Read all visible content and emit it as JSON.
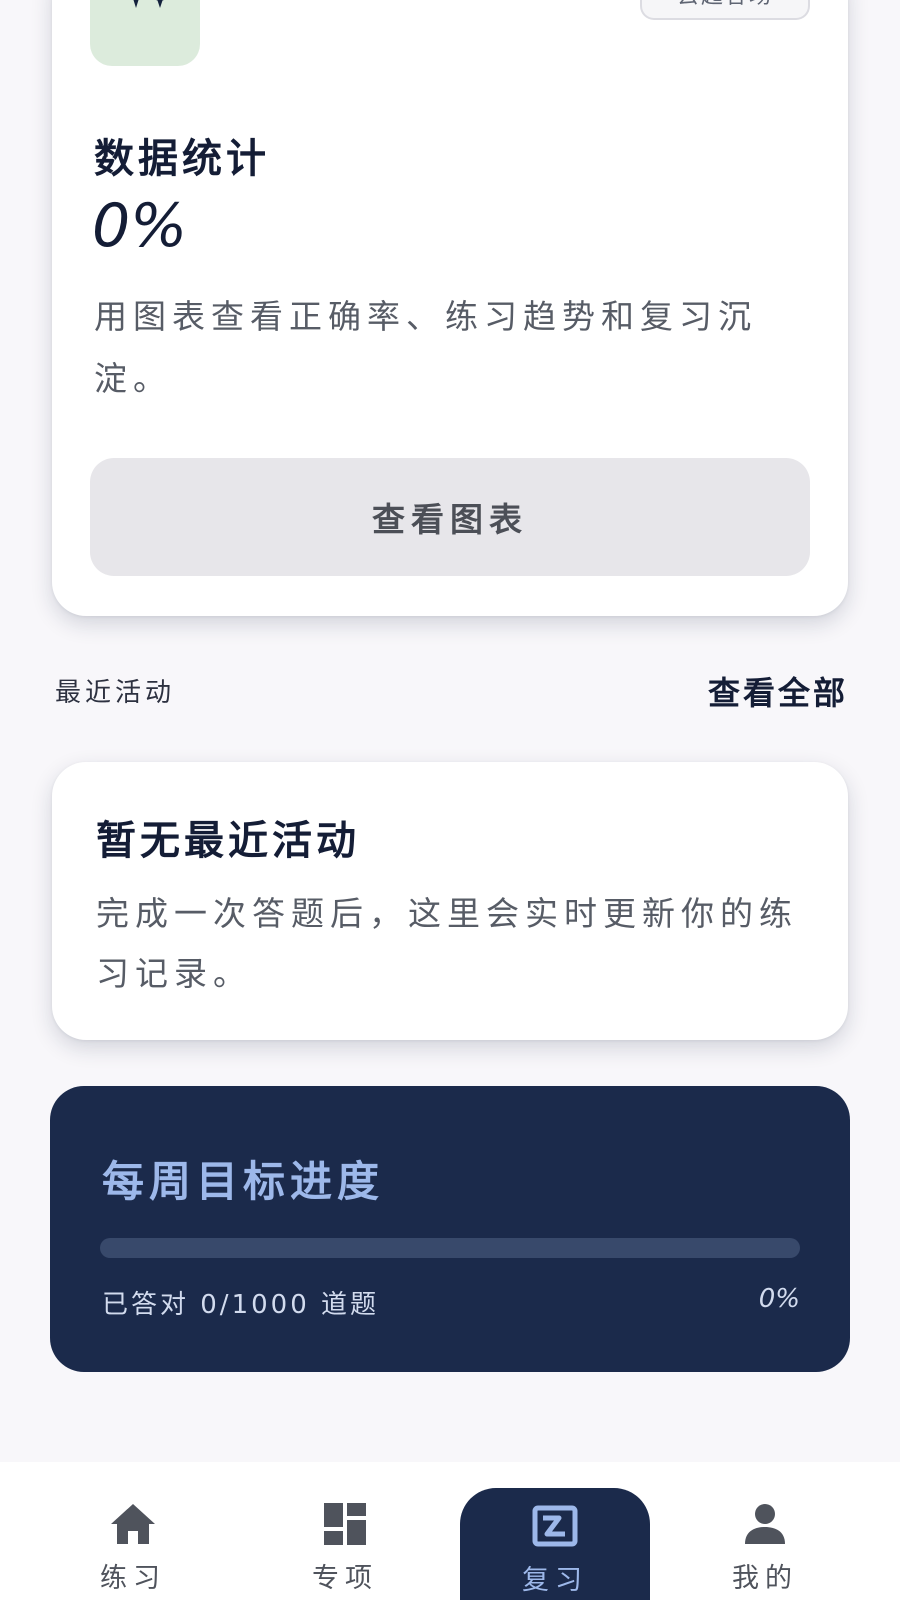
{
  "stats_card": {
    "chip_label": "去起答场",
    "title": "数据统计",
    "value": "0%",
    "description": "用图表查看正确率、练习趋势和复习沉淀。",
    "button_label": "查看图表",
    "icon": "sparkle-icon"
  },
  "recent": {
    "section_label": "最近活动",
    "view_all_label": "查看全部"
  },
  "activity_card": {
    "title": "暂无最近活动",
    "description": "完成一次答题后，这里会实时更新你的练习记录。"
  },
  "weekly_goal": {
    "title": "每周目标进度",
    "caption": "已答对 0/1000 道题",
    "percent_label": "0%",
    "progress_fraction": 0
  },
  "bottom_nav": {
    "items": [
      {
        "label": "练习",
        "icon": "home-icon",
        "active": false
      },
      {
        "label": "专项",
        "icon": "dashboard-icon",
        "active": false
      },
      {
        "label": "复习",
        "icon": "review-icon",
        "active": true
      },
      {
        "label": "我的",
        "icon": "person-icon",
        "active": false
      }
    ]
  },
  "colors": {
    "accent_dark": "#1b2a4b",
    "accent_light": "#9db8ea",
    "sparkle_tile": "#dcebdc",
    "background": "#f8f7fa"
  }
}
